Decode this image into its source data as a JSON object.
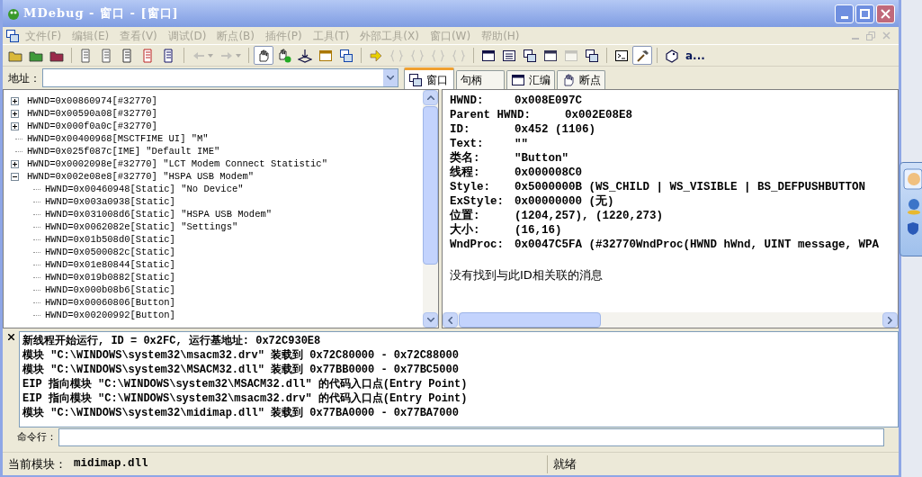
{
  "window": {
    "title": "MDebug - 窗口 - [窗口]"
  },
  "menu": [
    {
      "label": "文件(F)",
      "disabled": true
    },
    {
      "label": "编辑(E)",
      "disabled": true
    },
    {
      "label": "查看(V)",
      "disabled": true
    },
    {
      "label": "调试(D)",
      "disabled": true
    },
    {
      "label": "断点(B)",
      "disabled": true
    },
    {
      "label": "插件(P)",
      "disabled": true
    },
    {
      "label": "工具(T)",
      "disabled": true
    },
    {
      "label": "外部工具(X)",
      "disabled": true
    },
    {
      "label": "窗口(W)",
      "disabled": true
    },
    {
      "label": "帮助(H)",
      "disabled": true
    }
  ],
  "toolbar": [
    {
      "kind": "button",
      "disabled": false,
      "pressed": false
    },
    {
      "kind": "button",
      "disabled": false,
      "pressed": false
    },
    {
      "kind": "button",
      "disabled": false,
      "pressed": false
    },
    {
      "kind": "separator"
    },
    {
      "kind": "button",
      "disabled": false,
      "pressed": false
    },
    {
      "kind": "button",
      "disabled": false,
      "pressed": false
    },
    {
      "kind": "button",
      "disabled": false,
      "pressed": false
    },
    {
      "kind": "button",
      "disabled": false,
      "pressed": false
    },
    {
      "kind": "button",
      "disabled": false,
      "pressed": false
    },
    {
      "kind": "separator"
    },
    {
      "kind": "dropdown",
      "disabled": true,
      "pressed": false
    },
    {
      "kind": "dropdown",
      "disabled": true,
      "pressed": false
    },
    {
      "kind": "separator"
    },
    {
      "kind": "button",
      "disabled": false,
      "pressed": true
    },
    {
      "kind": "button",
      "disabled": false,
      "pressed": false
    },
    {
      "kind": "button",
      "disabled": false,
      "pressed": false
    },
    {
      "kind": "button",
      "disabled": false,
      "pressed": false
    },
    {
      "kind": "button",
      "disabled": false,
      "pressed": false
    },
    {
      "kind": "separator"
    },
    {
      "kind": "button",
      "disabled": false,
      "pressed": false
    },
    {
      "kind": "button",
      "disabled": true,
      "pressed": false
    },
    {
      "kind": "button",
      "disabled": true,
      "pressed": false
    },
    {
      "kind": "button",
      "disabled": true,
      "pressed": false
    },
    {
      "kind": "button",
      "disabled": true,
      "pressed": false
    },
    {
      "kind": "separator"
    },
    {
      "kind": "button",
      "disabled": false,
      "pressed": false
    },
    {
      "kind": "button",
      "disabled": false,
      "pressed": false
    },
    {
      "kind": "button",
      "disabled": false,
      "pressed": false
    },
    {
      "kind": "button",
      "disabled": false,
      "pressed": false
    },
    {
      "kind": "button",
      "disabled": true,
      "pressed": false
    },
    {
      "kind": "button",
      "disabled": false,
      "pressed": false
    },
    {
      "kind": "separator"
    },
    {
      "kind": "button",
      "disabled": false,
      "pressed": false
    },
    {
      "kind": "button",
      "disabled": false,
      "pressed": true
    },
    {
      "kind": "separator"
    },
    {
      "kind": "button",
      "disabled": false,
      "pressed": false
    },
    {
      "kind": "text",
      "label": "a..."
    }
  ],
  "address": {
    "label": "地址："
  },
  "tabs": [
    {
      "label": "窗口",
      "selected": true
    },
    {
      "label": "句柄",
      "selected": false
    },
    {
      "label": "汇编",
      "selected": false
    },
    {
      "label": "断点",
      "selected": false
    }
  ],
  "tree": [
    {
      "label": "HWND=0x00860974[#32770]",
      "kind": "collapsed"
    },
    {
      "label": "HWND=0x00590a08[#32770]",
      "kind": "collapsed"
    },
    {
      "label": "HWND=0x000f0a0c[#32770]",
      "kind": "collapsed"
    },
    {
      "label": "HWND=0x00400968[MSCTFIME UI] \"M\"",
      "kind": "leaf"
    },
    {
      "label": "HWND=0x025f087c[IME] \"Default IME\"",
      "kind": "leaf"
    },
    {
      "label": "HWND=0x0002098e[#32770] \"LCT Modem Connect Statistic\"",
      "kind": "collapsed"
    },
    {
      "label": "HWND=0x002e08e8[#32770] \"HSPA USB Modem\"",
      "kind": "expanded",
      "children": [
        {
          "label": "HWND=0x00460948[Static] \"No Device\"",
          "kind": "leaf"
        },
        {
          "label": "HWND=0x003a0938[Static]",
          "kind": "leaf"
        },
        {
          "label": "HWND=0x031008d6[Static] \"HSPA USB Modem\"",
          "kind": "leaf"
        },
        {
          "label": "HWND=0x0062082e[Static] \"Settings\"",
          "kind": "leaf"
        },
        {
          "label": "HWND=0x01b508d0[Static]",
          "kind": "leaf"
        },
        {
          "label": "HWND=0x0500082c[Static]",
          "kind": "leaf"
        },
        {
          "label": "HWND=0x01e80844[Static]",
          "kind": "leaf"
        },
        {
          "label": "HWND=0x019b0882[Static]",
          "kind": "leaf"
        },
        {
          "label": "HWND=0x000b08b6[Static]",
          "kind": "leaf"
        },
        {
          "label": "HWND=0x00060806[Button]",
          "kind": "leaf"
        },
        {
          "label": "HWND=0x00200992[Button]",
          "kind": "leaf"
        }
      ]
    }
  ],
  "details": {
    "rows": [
      {
        "label": "HWND:",
        "value": "0x008E097C"
      },
      {
        "label": "Parent HWND:",
        "value": "0x002E08E8"
      },
      {
        "label": "ID:",
        "value": "0x452 (1106)"
      },
      {
        "label": "Text:",
        "value": "\"\""
      },
      {
        "label": "类名:",
        "value": "\"Button\""
      },
      {
        "label": "线程:",
        "value": "0x000008C0"
      },
      {
        "label": "Style:",
        "value": "0x5000000B  (WS_CHILD | WS_VISIBLE | BS_DEFPUSHBUTTON"
      },
      {
        "label": "ExStyle:",
        "value": "0x00000000  (无)"
      },
      {
        "label": "位置:",
        "value": "(1204,257), (1220,273)"
      },
      {
        "label": "大小:",
        "value": "(16,16)"
      },
      {
        "label": "WndProc:",
        "value": "0x0047C5FA (#32770WndProc(HWND hWnd, UINT message, WPA"
      }
    ],
    "message": "没有找到与此ID相关联的消息"
  },
  "output": {
    "lines": [
      "新线程开始运行, ID = 0x2FC, 运行基地址: 0x72C930E8",
      "模块 \"C:\\WINDOWS\\system32\\msacm32.drv\"  装载到 0x72C80000 - 0x72C88000",
      "模块 \"C:\\WINDOWS\\system32\\MSACM32.dll\"  装载到 0x77BB0000 - 0x77BC5000",
      "EIP 指向模块 \"C:\\WINDOWS\\system32\\MSACM32.dll\" 的代码入口点(Entry Point)",
      "EIP 指向模块 \"C:\\WINDOWS\\system32\\msacm32.drv\" 的代码入口点(Entry Point)",
      "模块 \"C:\\WINDOWS\\system32\\midimap.dll\"  装载到 0x77BA0000 - 0x77BA7000"
    ]
  },
  "command": {
    "label": "命令行："
  },
  "status_bar": {
    "module_label": "当前模块：",
    "module": "midimap.dll",
    "state": "就绪"
  }
}
